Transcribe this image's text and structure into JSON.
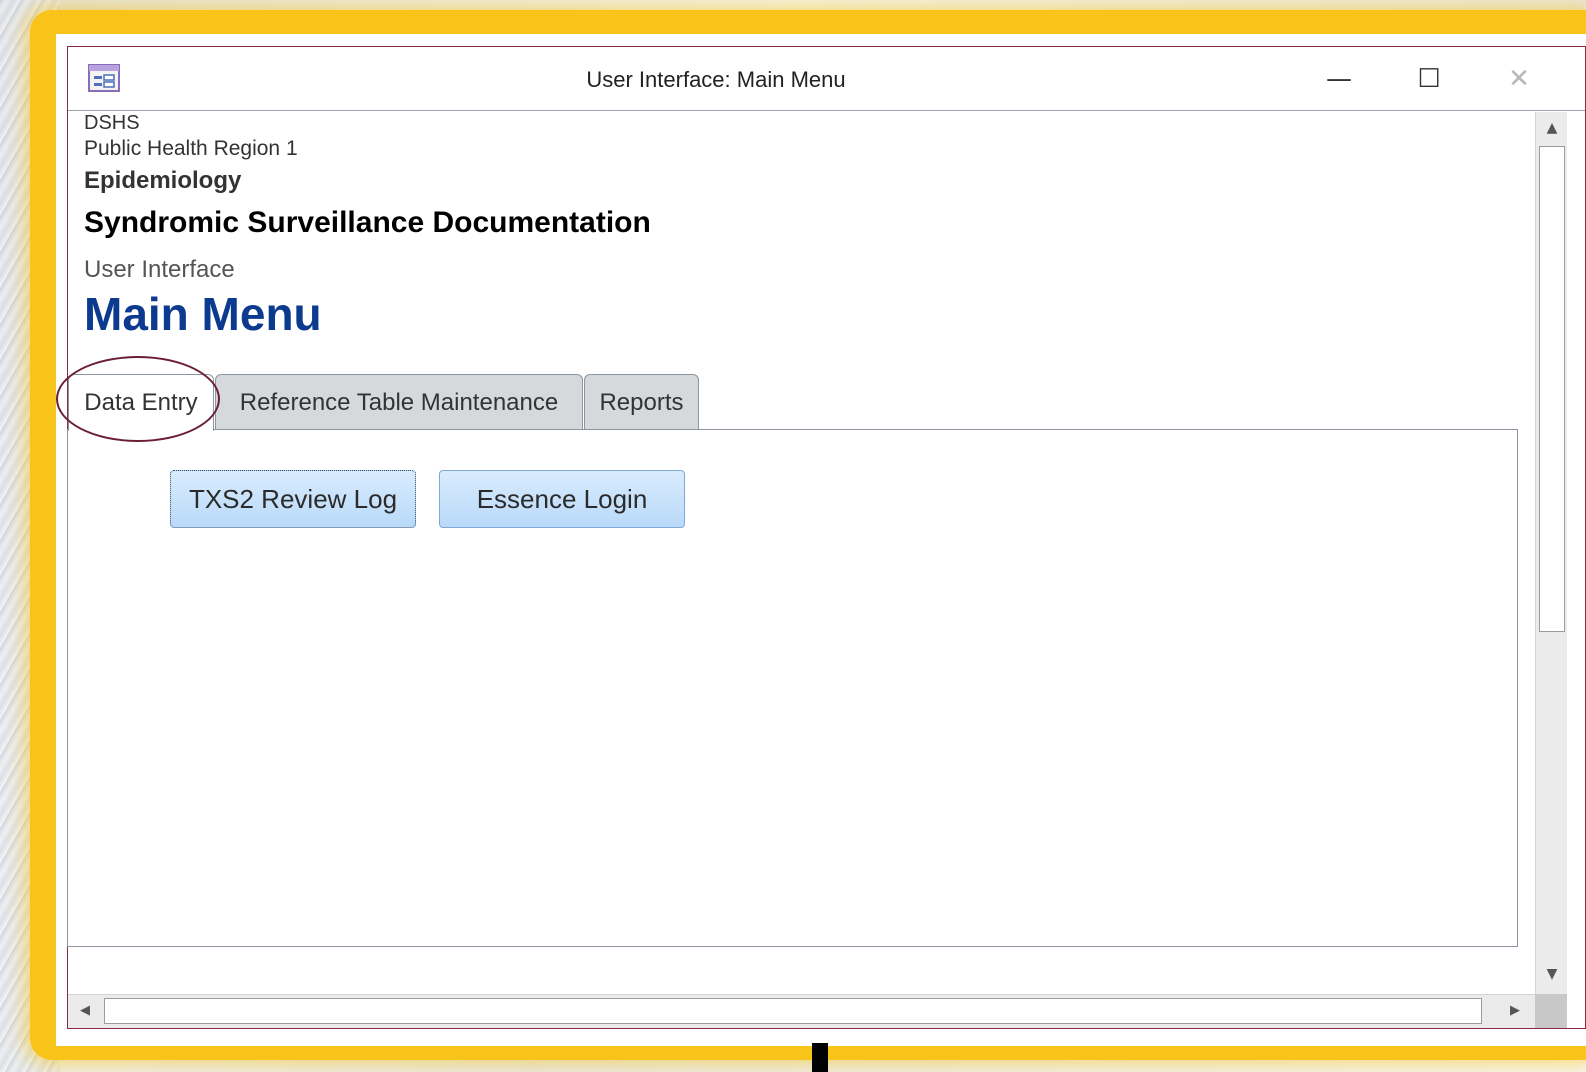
{
  "window": {
    "title": "User Interface: Main Menu",
    "icon": "form-icon",
    "controls": {
      "minimize": "—",
      "maximize": "☐",
      "close": "✕"
    }
  },
  "header": {
    "org": "DSHS",
    "region": "Public Health Region 1",
    "department": "Epidemiology",
    "document_title": "Syndromic Surveillance Documentation",
    "subtitle": "User Interface",
    "page_title": "Main Menu"
  },
  "tabs": [
    {
      "label": "Data Entry",
      "active": true
    },
    {
      "label": "Reference Table Maintenance",
      "active": false
    },
    {
      "label": "Reports",
      "active": false
    }
  ],
  "data_entry": {
    "buttons": [
      {
        "label": "TXS2 Review Log",
        "focused": true
      },
      {
        "label": "Essence Login",
        "focused": false
      }
    ]
  },
  "scrollbars": {
    "up": "▲",
    "down": "▼",
    "left": "◀",
    "right": "▶"
  },
  "colors": {
    "highlight": "#f9c41a",
    "title_accent": "#0b3a8f",
    "annotation_circle": "#6b1f33"
  }
}
